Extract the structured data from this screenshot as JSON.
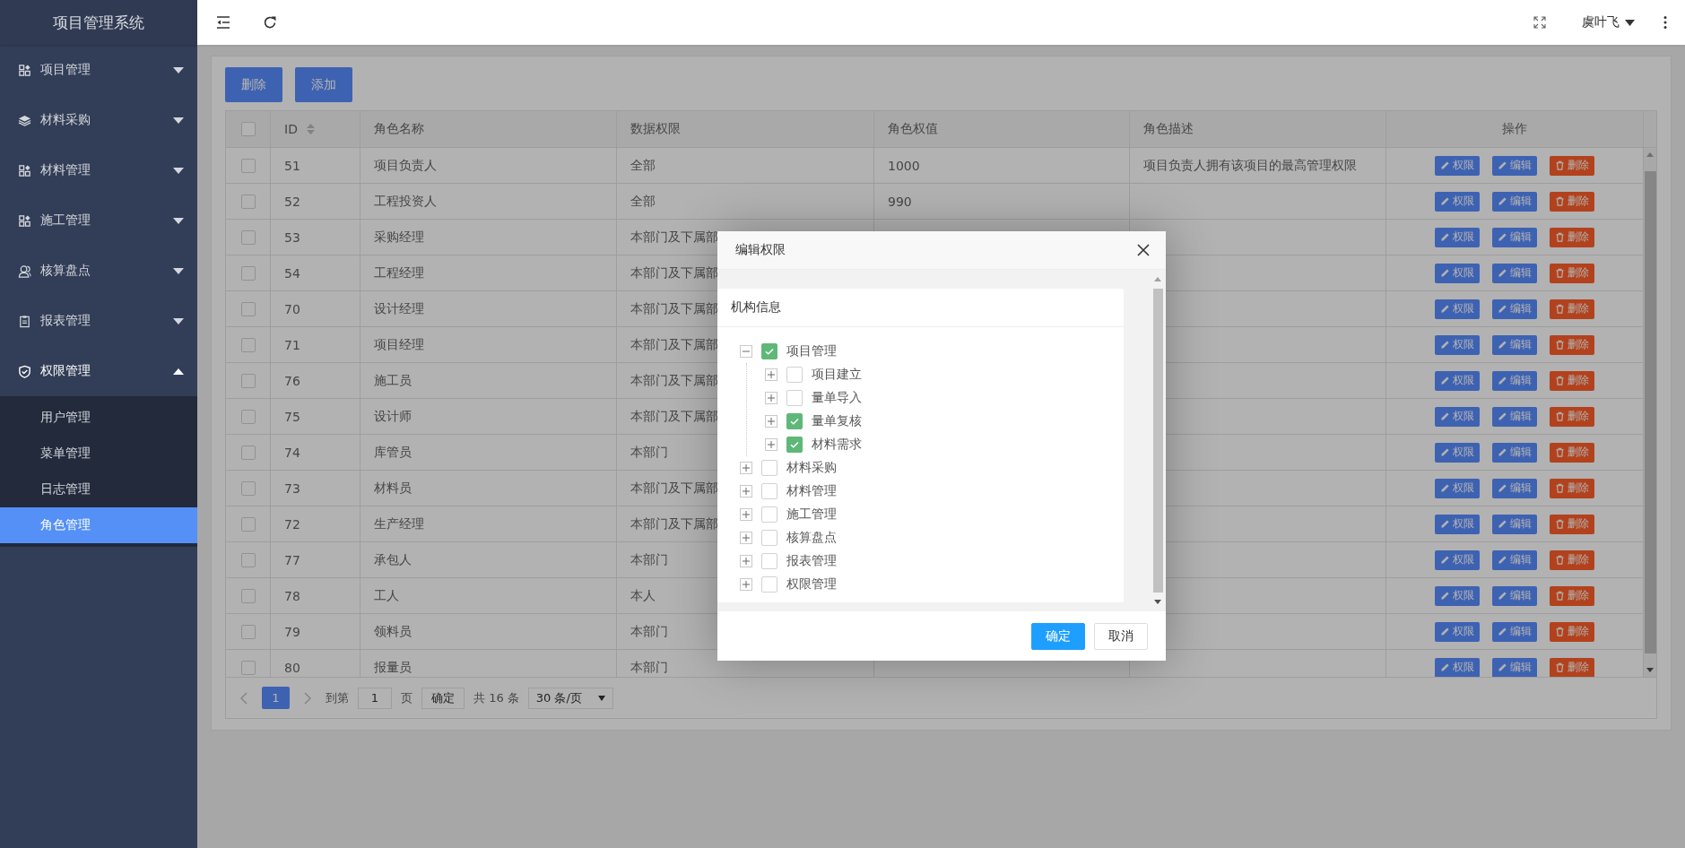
{
  "sidebar": {
    "title": "项目管理系统",
    "items": [
      {
        "label": "项目管理",
        "expanded": false
      },
      {
        "label": "材料采购",
        "expanded": false
      },
      {
        "label": "材料管理",
        "expanded": false
      },
      {
        "label": "施工管理",
        "expanded": false
      },
      {
        "label": "核算盘点",
        "expanded": false
      },
      {
        "label": "报表管理",
        "expanded": false
      },
      {
        "label": "权限管理",
        "expanded": true,
        "children": [
          {
            "label": "用户管理",
            "selected": false
          },
          {
            "label": "菜单管理",
            "selected": false
          },
          {
            "label": "日志管理",
            "selected": false
          },
          {
            "label": "角色管理",
            "selected": true
          }
        ]
      }
    ]
  },
  "header": {
    "user": "虞叶飞"
  },
  "toolbar": {
    "buttons": [
      "删除",
      "添加"
    ]
  },
  "table": {
    "all_checked": false,
    "columns": [
      {
        "label": "ID",
        "sortable": true
      },
      {
        "label": "角色名称",
        "sortable": false
      },
      {
        "label": "数据权限",
        "sortable": false
      },
      {
        "label": "角色权值",
        "sortable": false
      },
      {
        "label": "角色描述",
        "sortable": false
      },
      {
        "label": "操作",
        "sortable": false
      }
    ],
    "rows": [
      {
        "checked": false,
        "id": "51",
        "name": "项目负责人",
        "scope": "全部",
        "weight": "1000",
        "description": "项目负责人拥有该项目的最高管理权限",
        "actions": [
          {
            "label": "权限",
            "kind": "normal"
          },
          {
            "label": "编辑",
            "kind": "normal"
          },
          {
            "label": "删除",
            "kind": "danger"
          }
        ]
      },
      {
        "checked": false,
        "id": "52",
        "name": "工程投资人",
        "scope": "全部",
        "weight": "990",
        "actions": [
          {
            "label": "权限",
            "kind": "normal"
          },
          {
            "label": "编辑",
            "kind": "normal"
          },
          {
            "label": "删除",
            "kind": "danger"
          }
        ]
      },
      {
        "checked": false,
        "id": "53",
        "name": "采购经理",
        "scope": "本部门及下属部",
        "actions": [
          {
            "label": "权限",
            "kind": "normal"
          },
          {
            "label": "编辑",
            "kind": "normal"
          },
          {
            "label": "删除",
            "kind": "danger"
          }
        ]
      },
      {
        "checked": false,
        "id": "54",
        "name": "工程经理",
        "scope": "本部门及下属部",
        "actions": [
          {
            "label": "权限",
            "kind": "normal"
          },
          {
            "label": "编辑",
            "kind": "normal"
          },
          {
            "label": "删除",
            "kind": "danger"
          }
        ]
      },
      {
        "checked": false,
        "id": "70",
        "name": "设计经理",
        "scope": "本部门及下属部",
        "actions": [
          {
            "label": "权限",
            "kind": "normal"
          },
          {
            "label": "编辑",
            "kind": "normal"
          },
          {
            "label": "删除",
            "kind": "danger"
          }
        ]
      },
      {
        "checked": false,
        "id": "71",
        "name": "项目经理",
        "scope": "本部门及下属部",
        "actions": [
          {
            "label": "权限",
            "kind": "normal"
          },
          {
            "label": "编辑",
            "kind": "normal"
          },
          {
            "label": "删除",
            "kind": "danger"
          }
        ]
      },
      {
        "checked": false,
        "id": "76",
        "name": "施工员",
        "scope": "本部门及下属部",
        "actions": [
          {
            "label": "权限",
            "kind": "normal"
          },
          {
            "label": "编辑",
            "kind": "normal"
          },
          {
            "label": "删除",
            "kind": "danger"
          }
        ]
      },
      {
        "checked": false,
        "id": "75",
        "name": "设计师",
        "scope": "本部门及下属部",
        "actions": [
          {
            "label": "权限",
            "kind": "normal"
          },
          {
            "label": "编辑",
            "kind": "normal"
          },
          {
            "label": "删除",
            "kind": "danger"
          }
        ]
      },
      {
        "checked": false,
        "id": "74",
        "name": "库管员",
        "scope": "本部门",
        "actions": [
          {
            "label": "权限",
            "kind": "normal"
          },
          {
            "label": "编辑",
            "kind": "normal"
          },
          {
            "label": "删除",
            "kind": "danger"
          }
        ]
      },
      {
        "checked": false,
        "id": "73",
        "name": "材料员",
        "scope": "本部门及下属部",
        "actions": [
          {
            "label": "权限",
            "kind": "normal"
          },
          {
            "label": "编辑",
            "kind": "normal"
          },
          {
            "label": "删除",
            "kind": "danger"
          }
        ]
      },
      {
        "checked": false,
        "id": "72",
        "name": "生产经理",
        "scope": "本部门及下属部",
        "actions": [
          {
            "label": "权限",
            "kind": "normal"
          },
          {
            "label": "编辑",
            "kind": "normal"
          },
          {
            "label": "删除",
            "kind": "danger"
          }
        ]
      },
      {
        "checked": false,
        "id": "77",
        "name": "承包人",
        "scope": "本部门",
        "actions": [
          {
            "label": "权限",
            "kind": "normal"
          },
          {
            "label": "编辑",
            "kind": "normal"
          },
          {
            "label": "删除",
            "kind": "danger"
          }
        ]
      },
      {
        "checked": false,
        "id": "78",
        "name": "工人",
        "scope": "本人",
        "actions": [
          {
            "label": "权限",
            "kind": "normal"
          },
          {
            "label": "编辑",
            "kind": "normal"
          },
          {
            "label": "删除",
            "kind": "danger"
          }
        ]
      },
      {
        "checked": false,
        "id": "79",
        "name": "领料员",
        "scope": "本部门",
        "actions": [
          {
            "label": "权限",
            "kind": "normal"
          },
          {
            "label": "编辑",
            "kind": "normal"
          },
          {
            "label": "删除",
            "kind": "danger"
          }
        ]
      },
      {
        "checked": false,
        "id": "80",
        "name": "报量员",
        "scope": "本部门",
        "actions": [
          {
            "label": "权限",
            "kind": "normal"
          },
          {
            "label": "编辑",
            "kind": "normal"
          },
          {
            "label": "删除",
            "kind": "danger"
          }
        ]
      }
    ]
  },
  "pagination": {
    "pages": [
      {
        "label": "1",
        "selected": true
      }
    ],
    "goto_label": "到第",
    "goto_value": "1",
    "page_unit": "页",
    "confirm": "确定",
    "total": "共 16 条",
    "page_size": "30 条/页"
  },
  "dialog": {
    "title": "编辑权限",
    "section": "机构信息",
    "tree": [
      {
        "label": "项目管理",
        "checked": true,
        "expanded": true,
        "children": [
          {
            "label": "项目建立",
            "checked": false,
            "expanded": false
          },
          {
            "label": "量单导入",
            "checked": false,
            "expanded": false
          },
          {
            "label": "量单复核",
            "checked": true,
            "expanded": false
          },
          {
            "label": "材料需求",
            "checked": true,
            "expanded": false
          }
        ]
      },
      {
        "label": "材料采购",
        "checked": false,
        "expanded": false
      },
      {
        "label": "材料管理",
        "checked": false,
        "expanded": false
      },
      {
        "label": "施工管理",
        "checked": false,
        "expanded": false
      },
      {
        "label": "核算盘点",
        "checked": false,
        "expanded": false
      },
      {
        "label": "报表管理",
        "checked": false,
        "expanded": false
      },
      {
        "label": "权限管理",
        "checked": false,
        "expanded": false
      }
    ],
    "buttons": [
      {
        "label": "确定",
        "kind": "primary"
      },
      {
        "label": "取消",
        "kind": "default"
      }
    ]
  }
}
